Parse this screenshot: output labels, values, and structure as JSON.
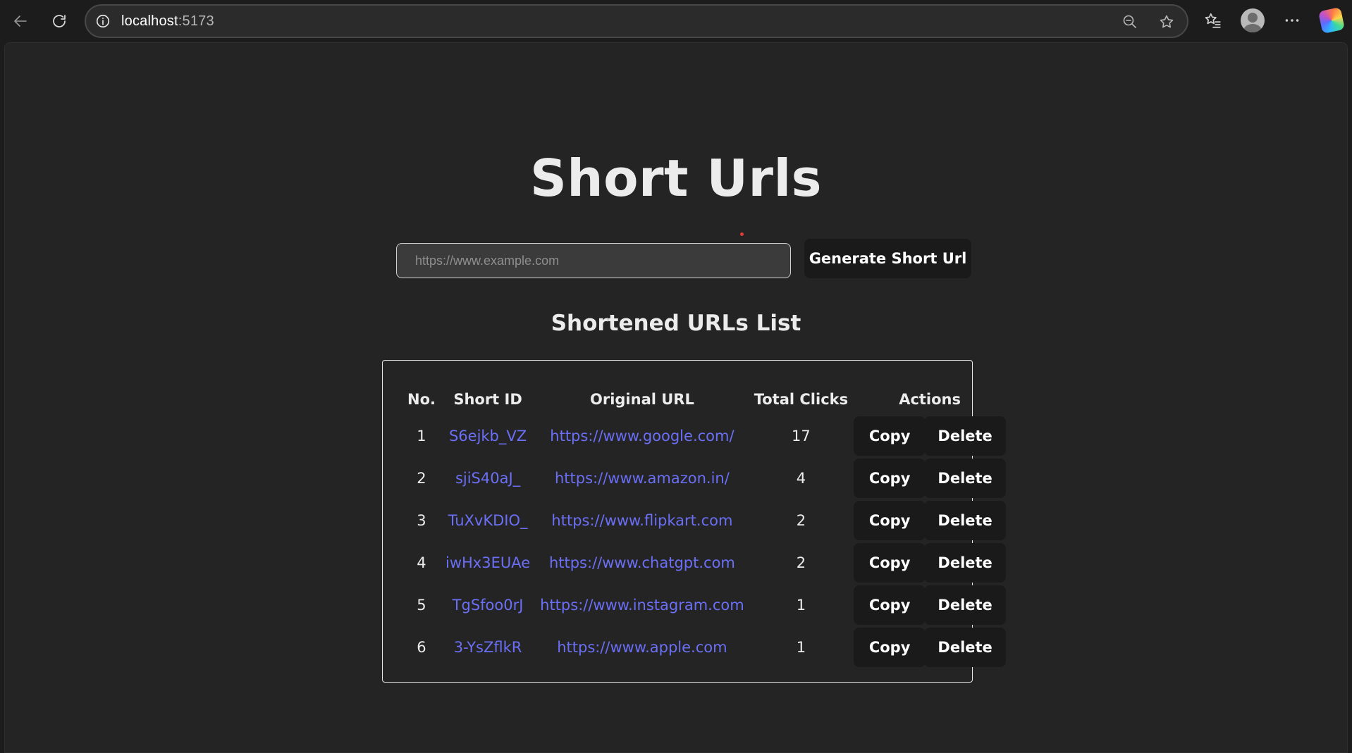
{
  "browser": {
    "url_host": "localhost",
    "url_port": ":5173",
    "icons": [
      "back-arrow-icon",
      "refresh-icon",
      "site-info-icon",
      "zoom-out-icon",
      "favorite-star-icon",
      "favorites-list-icon",
      "profile-avatar-icon",
      "more-options-icon",
      "copilot-icon"
    ]
  },
  "page": {
    "title": "Short Urls",
    "input_placeholder": "https://www.example.com",
    "input_value": "",
    "generate_label": "Generate Short Url",
    "list_title": "Shortened URLs List"
  },
  "table": {
    "headers": {
      "no": "No.",
      "short_id": "Short ID",
      "original_url": "Original URL",
      "total_clicks": "Total Clicks",
      "actions": "Actions"
    },
    "copy_label": "Copy",
    "delete_label": "Delete",
    "rows": [
      {
        "no": "1",
        "short_id": "S6ejkb_VZ",
        "original_url": "https://www.google.com/",
        "clicks": "17"
      },
      {
        "no": "2",
        "short_id": "sjiS40aJ_",
        "original_url": "https://www.amazon.in/",
        "clicks": "4"
      },
      {
        "no": "3",
        "short_id": "TuXvKDIO_",
        "original_url": "https://www.flipkart.com",
        "clicks": "2"
      },
      {
        "no": "4",
        "short_id": "iwHx3EUAe",
        "original_url": "https://www.chatgpt.com",
        "clicks": "2"
      },
      {
        "no": "5",
        "short_id": "TgSfoo0rJ",
        "original_url": "https://www.instagram.com",
        "clicks": "1"
      },
      {
        "no": "6",
        "short_id": "3-YsZflkR",
        "original_url": "https://www.apple.com",
        "clicks": "1"
      }
    ]
  },
  "colors": {
    "page_bg": "#242424",
    "chrome_bg": "#1c1c1c",
    "button_bg": "#1a1a1a",
    "link": "#6b6ff5",
    "text": "#ececec"
  }
}
